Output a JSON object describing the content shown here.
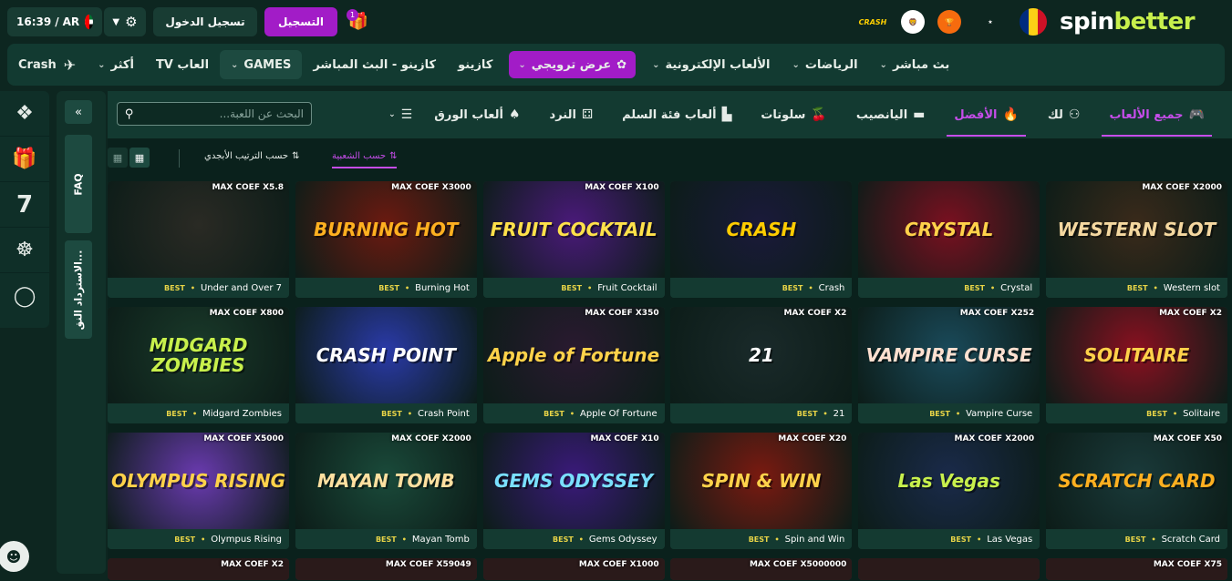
{
  "topbar": {
    "time": "16:39",
    "lang": "AR",
    "settings_icon": "gear-icon",
    "login_label": "تسجيل الدخول",
    "register_label": "التسجيل",
    "gift_badge": "1",
    "brand_crash": "CRASH",
    "logo_spin": "spin",
    "logo_better": "better"
  },
  "nav": {
    "items": [
      "بث مباشر",
      "الرياضات",
      "الألعاب الإلكترونية",
      "عرض ترويجي",
      "كازينو",
      "كازينو - البث المباشر",
      "GAMES",
      "العاب TV",
      "أكثر",
      "Crash"
    ]
  },
  "categories": {
    "items": [
      "جميع الألعاب",
      "لك",
      "الأفضل",
      "اليانصيب",
      "سلوتات",
      "ألعاب فئة السلم",
      "النرد",
      "ألعاب الورق"
    ]
  },
  "search": {
    "placeholder": "البحث عن اللعبة..."
  },
  "sort": {
    "popular": "حسب الشعبية",
    "alphabetical": "حسب الترتيب الأبجدي"
  },
  "side": {
    "faq": "FAQ",
    "refund": "الاسترداد النق..."
  },
  "best_label": "BEST",
  "games": [
    {
      "name": "Under and Over 7",
      "coef": "MAX COEF X5.8",
      "bg": "#2a2a24",
      "fg": "#ffffff"
    },
    {
      "name": "Burning Hot",
      "coef": "MAX COEF X3000",
      "bg": "#6b1a10",
      "fg": "#ffb020"
    },
    {
      "name": "Fruit Cocktail",
      "coef": "MAX COEF X100",
      "bg": "#4a1a7a",
      "fg": "#ffe14a"
    },
    {
      "name": "Crash",
      "coef": "",
      "bg": "#1a1a3a",
      "fg": "#ffcc00"
    },
    {
      "name": "Crystal",
      "coef": "",
      "bg": "#7a1020",
      "fg": "#ffd24a"
    },
    {
      "name": "Western slot",
      "coef": "MAX COEF X2000",
      "bg": "#3a2a1a",
      "fg": "#f5d8a0"
    },
    {
      "name": "Midgard Zombies",
      "coef": "MAX COEF X800",
      "bg": "#1a3a2a",
      "fg": "#c8f04c"
    },
    {
      "name": "Crash Point",
      "coef": "",
      "bg": "#2a3aa8",
      "fg": "#ffffff"
    },
    {
      "name": "Apple Of Fortune",
      "coef": "MAX COEF X350",
      "bg": "#2a1a30",
      "fg": "#ffd24a"
    },
    {
      "name": "21",
      "coef": "MAX COEF X2",
      "bg": "#1a2a2a",
      "fg": "#ffffff"
    },
    {
      "name": "Vampire Curse",
      "coef": "MAX COEF X252",
      "bg": "#1a4a5a",
      "fg": "#ffe0d0"
    },
    {
      "name": "Solitaire",
      "coef": "MAX COEF X2",
      "bg": "#8a1020",
      "fg": "#ffd24a"
    },
    {
      "name": "Olympus Rising",
      "coef": "MAX COEF X5000",
      "bg": "#6a3ab0",
      "fg": "#ffd24a"
    },
    {
      "name": "Mayan Tomb",
      "coef": "MAX COEF X2000",
      "bg": "#1a4a3a",
      "fg": "#ffe0a0"
    },
    {
      "name": "Gems Odyssey",
      "coef": "MAX COEF X10",
      "bg": "#3a1a7a",
      "fg": "#7ae0ff"
    },
    {
      "name": "Spin and Win",
      "coef": "MAX COEF X20",
      "bg": "#7a1a10",
      "fg": "#ffd24a"
    },
    {
      "name": "Las Vegas",
      "coef": "MAX COEF X2000",
      "bg": "#1a2a4a",
      "fg": "#c8f04c"
    },
    {
      "name": "Scratch Card",
      "coef": "MAX COEF X50",
      "bg": "#1a3a3a",
      "fg": "#ffb020"
    }
  ],
  "art_titles": [
    "",
    "BURNING HOT",
    "FRUIT COCKTAIL",
    "CRASH",
    "CRYSTAL",
    "WESTERN SLOT",
    "MIDGARD ZOMBIES",
    "CRASH POINT",
    "Apple of Fortune",
    "21",
    "VAMPIRE CURSE",
    "SOLITAIRE",
    "OLYMPUS RISING",
    "MAYAN TOMB",
    "GEMS ODYSSEY",
    "SPIN & WIN",
    "Las Vegas",
    "SCRATCH CARD"
  ],
  "partial_coefs": [
    "MAX COEF X2",
    "MAX COEF X59049",
    "MAX COEF X1000",
    "MAX COEF X5000000",
    "",
    "MAX COEF X75"
  ],
  "rail_icons": [
    "bug-icon",
    "gift-icon",
    "seven-icon",
    "wheel-icon",
    "dollar-icon"
  ]
}
